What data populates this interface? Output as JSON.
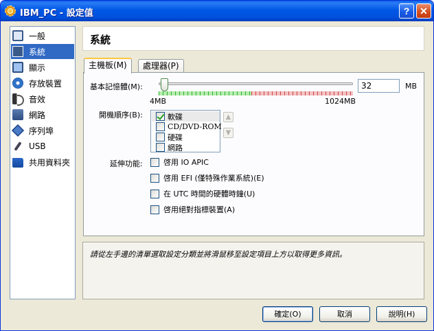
{
  "window": {
    "title": "IBM_PC - 設定值",
    "help_label": "?",
    "close_label": "✕"
  },
  "sidebar": {
    "items": [
      {
        "label": "一般",
        "icon": "monitor-icon"
      },
      {
        "label": "系統",
        "icon": "chip-icon",
        "selected": true
      },
      {
        "label": "顯示",
        "icon": "display-icon"
      },
      {
        "label": "存放裝置",
        "icon": "disc-icon"
      },
      {
        "label": "音效",
        "icon": "speaker-icon"
      },
      {
        "label": "網路",
        "icon": "network-icon"
      },
      {
        "label": "序列埠",
        "icon": "serial-icon"
      },
      {
        "label": "USB",
        "icon": "usb-icon"
      },
      {
        "label": "共用資料夾",
        "icon": "folder-icon"
      }
    ]
  },
  "header": {
    "title": "系統"
  },
  "tabs": [
    {
      "label": "主機板(M)",
      "active": true
    },
    {
      "label": "處理器(P)",
      "active": false
    }
  ],
  "motherboard": {
    "memory_label": "基本記憶體(M):",
    "memory_value": "32",
    "memory_unit": "MB",
    "memory_min_label": "4MB",
    "memory_max_label": "1024MB",
    "memory_fraction": 0.027,
    "boot_order_label": "開機順序(B):",
    "boot_items": [
      {
        "label": "軟碟",
        "checked": true
      },
      {
        "label": "CD/DVD-ROM",
        "checked": false
      },
      {
        "label": "硬碟",
        "checked": false
      },
      {
        "label": "網路",
        "checked": false
      }
    ],
    "up_arrow": "▲",
    "down_arrow": "▼",
    "extended_label": "延伸功能:",
    "features": [
      {
        "label": "啓用 IO APIC",
        "checked": false
      },
      {
        "label": "啓用 EFI (僅特殊作業系統)(E)",
        "checked": false
      },
      {
        "label": "在 UTC 時間的硬體時鐘(U)",
        "checked": false
      },
      {
        "label": "啓用絕對指標裝置(A)",
        "checked": false
      }
    ]
  },
  "info": {
    "text": "請從左手邊的清單選取設定分類並將滑鼠移至設定項目上方以取得更多資訊。"
  },
  "buttons": {
    "ok": "確定(O)",
    "cancel": "取消",
    "help": "說明(H)"
  },
  "colors": {
    "titlebar": "#0058e6",
    "selection": "#316ac5",
    "tab_highlight": "#ffc83c",
    "slider_safe": "#2fb52f",
    "slider_warn": "#cc4a4a"
  }
}
